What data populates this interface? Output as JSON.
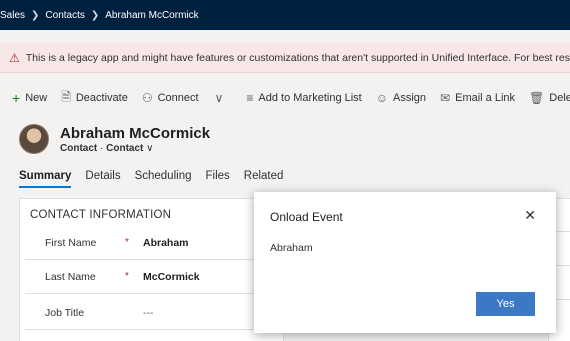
{
  "breadcrumb": {
    "items": [
      "Sales",
      "Contacts",
      "Abraham McCormick"
    ]
  },
  "banner": {
    "message": "This is a legacy app and might have features or customizations that aren't supported in Unified Interface. For best results, crea"
  },
  "commands": {
    "new": "New",
    "deactivate": "Deactivate",
    "connect": "Connect",
    "add_marketing": "Add to Marketing List",
    "assign": "Assign",
    "email_link": "Email a Link",
    "delete": "Delete"
  },
  "record": {
    "name": "Abraham McCormick",
    "entity": "Contact",
    "form": "Contact"
  },
  "tabs": [
    "Summary",
    "Details",
    "Scheduling",
    "Files",
    "Related"
  ],
  "contact_info": {
    "title": "CONTACT INFORMATION",
    "fields": [
      {
        "label": "First Name",
        "required": "*",
        "value": "Abraham"
      },
      {
        "label": "Last Name",
        "required": "*",
        "value": "McCormick"
      },
      {
        "label": "Job Title",
        "required": "",
        "value": "---"
      }
    ]
  },
  "dialog": {
    "title": "Onload Event",
    "message": "Abraham",
    "button": "Yes"
  },
  "colors": {
    "topbar": "#00203f",
    "accent": "#0078d4",
    "button": "#3b79c4",
    "banner": "#f8e7e7"
  }
}
